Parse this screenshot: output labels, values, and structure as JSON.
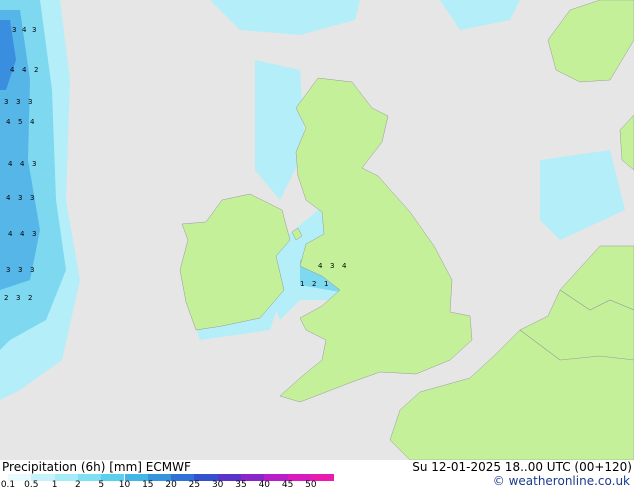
{
  "map": {
    "colors": {
      "sea": "#e6e6e6",
      "land": "#c4f09a",
      "precip_light": "#b4eef8",
      "precip_mid": "#7dd8f0",
      "precip_heavy": "#56b6e8",
      "precip_core": "#3a8ee0",
      "border": "#999999"
    }
  },
  "footer": {
    "title": "Precipitation (6h) [mm] ECMWF",
    "valid": "Su 12-01-2025 18..00 UTC (00+120)",
    "credit": "© weatheronline.co.uk",
    "legend": {
      "ticks": [
        "0.1",
        "0.5",
        "1",
        "2",
        "5",
        "10",
        "15",
        "20",
        "25",
        "30",
        "35",
        "40",
        "45",
        "50"
      ],
      "colors": [
        "#e8fbff",
        "#c6f3fb",
        "#a4ecf8",
        "#7fe0f4",
        "#5ccfee",
        "#42b6e6",
        "#3596de",
        "#2f73d6",
        "#3550cc",
        "#5a33c8",
        "#8a26c8",
        "#b81fc6",
        "#d81bc0",
        "#e81ab0"
      ]
    }
  }
}
